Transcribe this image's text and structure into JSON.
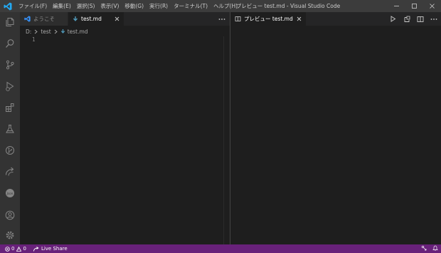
{
  "window": {
    "title": "プレビュー test.md - Visual Studio Code",
    "menu": [
      "ファイル(F)",
      "編集(E)",
      "選択(S)",
      "表示(V)",
      "移動(G)",
      "実行(R)",
      "ターミナル(T)",
      "ヘルプ(H)"
    ]
  },
  "activity_bar": {
    "items": [
      "explorer-icon",
      "search-icon",
      "source-control-icon",
      "run-debug-icon",
      "extensions-icon",
      "testing-icon",
      "git-graph-icon",
      "remote-icon",
      "json-icon",
      "account-icon",
      "settings-gear-icon"
    ]
  },
  "editor_left": {
    "tabs": [
      {
        "label": "ようこそ",
        "state": "inactive",
        "icon": "vscode-logo-icon"
      },
      {
        "label": "test.md",
        "state": "active",
        "icon": "markdown-icon"
      }
    ],
    "breadcrumb": [
      "D:",
      "test",
      "test.md"
    ],
    "line_numbers": [
      "1"
    ]
  },
  "editor_right": {
    "tabs": [
      {
        "label": "プレビュー test.md",
        "state": "active",
        "icon": "preview-icon"
      }
    ]
  },
  "status_bar": {
    "errors": "0",
    "warnings": "0",
    "live_share": "Live Share"
  },
  "colors": {
    "status_bar": "#68217a",
    "title_bar": "#3c3c3c",
    "activity_bar": "#333333",
    "editor_bg": "#1e1e1e",
    "tab_bar": "#252526",
    "accent_blue": "#3794ff"
  }
}
